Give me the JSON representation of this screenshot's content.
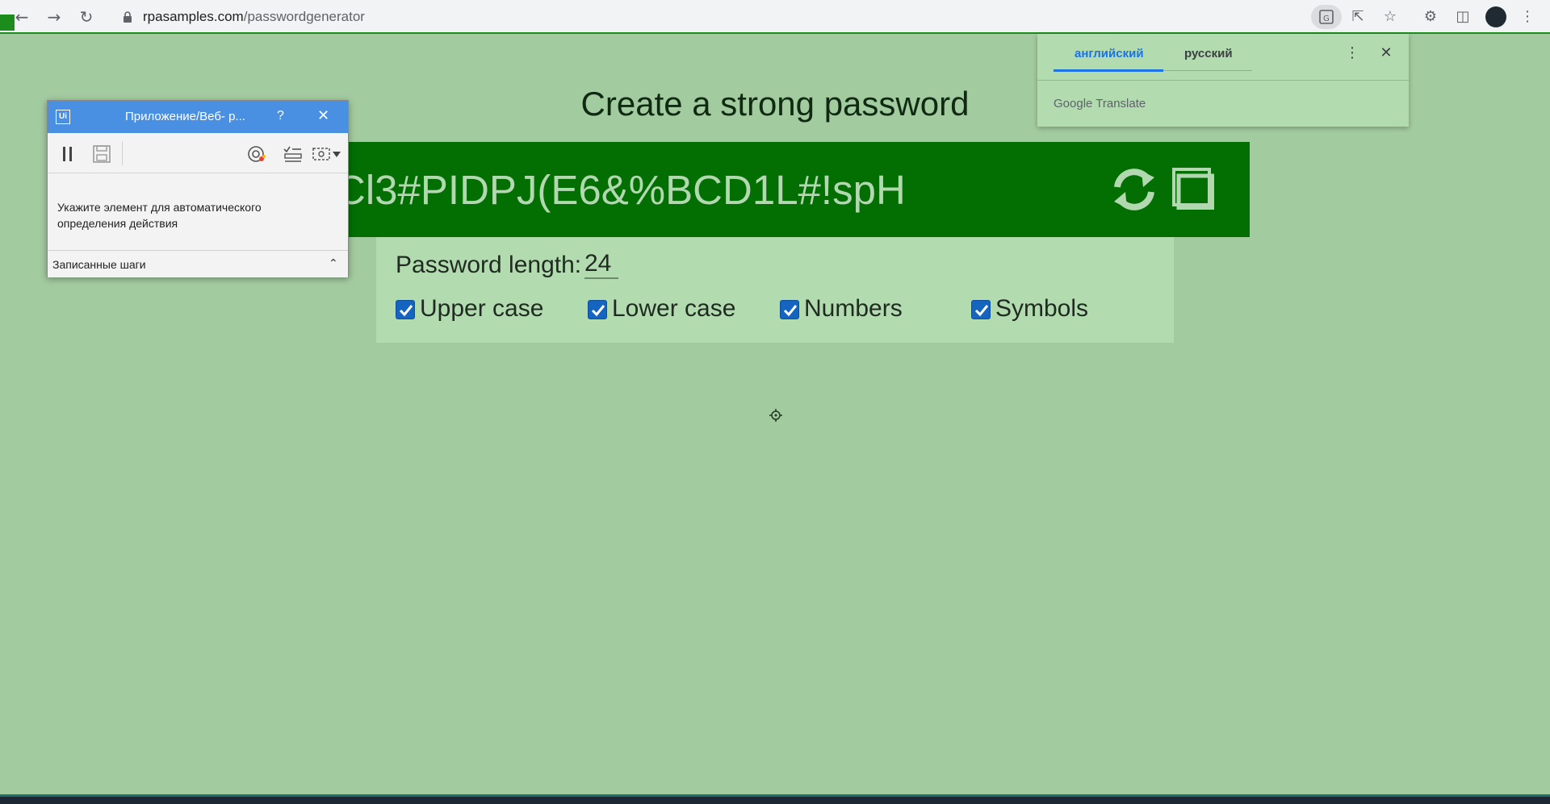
{
  "browser": {
    "url_host": "rpasamples.com",
    "url_path": "/passwordgenerator"
  },
  "page": {
    "title": "Create a strong password",
    "password_visible": "Cl3#PIDPJ(E6&%BCD1L#!spH",
    "length_label": "Password length:",
    "length_value": "24",
    "options": [
      {
        "label": "Upper case",
        "checked": true
      },
      {
        "label": "Lower case",
        "checked": true
      },
      {
        "label": "Numbers",
        "checked": true
      },
      {
        "label": "Symbols",
        "checked": true
      }
    ]
  },
  "translate_popup": {
    "tab_source": "английский",
    "tab_target": "русский",
    "brand": "Google Translate"
  },
  "recorder": {
    "title": "Приложение/Веб- р...",
    "help": "?",
    "hint": "Укажите элемент для автоматического определения действия",
    "steps_label": "Записанные шаги"
  },
  "colors": {
    "page_bg": "#a3cba0",
    "password_bar": "#036f03",
    "checkbox": "#1565c0",
    "recorder_title": "#4a90e2"
  }
}
